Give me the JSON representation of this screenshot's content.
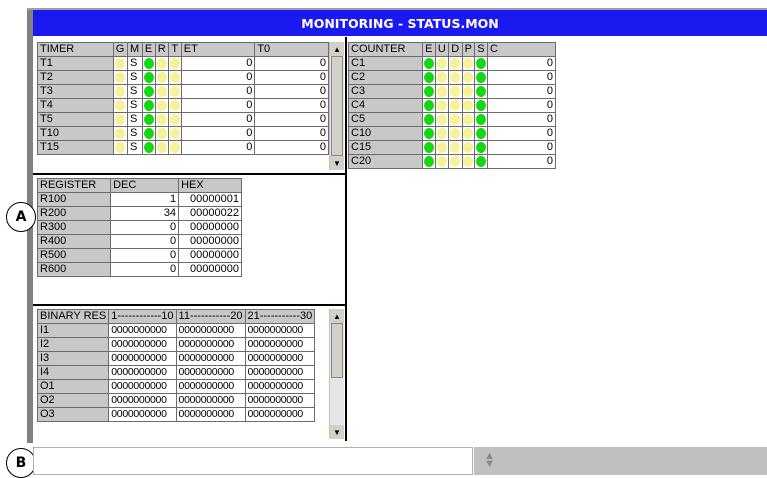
{
  "window": {
    "title": "MONITORING - STATUS.MON"
  },
  "timer": {
    "headers": [
      "TIMER",
      "G",
      "M",
      "E",
      "R",
      "T",
      "ET",
      "T0"
    ],
    "rows": [
      {
        "name": "T1",
        "m": "S",
        "et": "0",
        "t0": "0"
      },
      {
        "name": "T2",
        "m": "S",
        "et": "0",
        "t0": "0"
      },
      {
        "name": "T3",
        "m": "S",
        "et": "0",
        "t0": "0"
      },
      {
        "name": "T4",
        "m": "S",
        "et": "0",
        "t0": "0"
      },
      {
        "name": "T5",
        "m": "S",
        "et": "0",
        "t0": "0"
      },
      {
        "name": "T10",
        "m": "S",
        "et": "0",
        "t0": "0"
      },
      {
        "name": "T15",
        "m": "S",
        "et": "0",
        "t0": "0"
      }
    ]
  },
  "counter": {
    "headers": [
      "COUNTER",
      "E",
      "U",
      "D",
      "P",
      "S",
      "C"
    ],
    "rows": [
      {
        "name": "C1",
        "value": "0"
      },
      {
        "name": "C2",
        "value": "0"
      },
      {
        "name": "C3",
        "value": "0"
      },
      {
        "name": "C4",
        "value": "0"
      },
      {
        "name": "C5",
        "value": "0"
      },
      {
        "name": "C10",
        "value": "0"
      },
      {
        "name": "C15",
        "value": "0"
      },
      {
        "name": "C20",
        "value": "0"
      }
    ]
  },
  "register": {
    "headers": [
      "REGISTER",
      "DEC",
      "HEX"
    ],
    "rows": [
      {
        "name": "R100",
        "dec": "1",
        "hex": "00000001"
      },
      {
        "name": "R200",
        "dec": "34",
        "hex": "00000022"
      },
      {
        "name": "R300",
        "dec": "0",
        "hex": "00000000"
      },
      {
        "name": "R400",
        "dec": "0",
        "hex": "00000000"
      },
      {
        "name": "R500",
        "dec": "0",
        "hex": "00000000"
      },
      {
        "name": "R600",
        "dec": "0",
        "hex": "00000000"
      }
    ]
  },
  "binary": {
    "headers": [
      "BINARY RES",
      "1------------10",
      "11-----------20",
      "21-----------30"
    ],
    "rows": [
      {
        "name": "I1",
        "b1": "0000000000",
        "b2": "0000000000",
        "b3": "0000000000"
      },
      {
        "name": "I2",
        "b1": "0000000000",
        "b2": "0000000000",
        "b3": "0000000000"
      },
      {
        "name": "I3",
        "b1": "0000000000",
        "b2": "0000000000",
        "b3": "0000000000"
      },
      {
        "name": "I4",
        "b1": "0000000000",
        "b2": "0000000000",
        "b3": "0000000000"
      },
      {
        "name": "O1",
        "b1": "0000000000",
        "b2": "0000000000",
        "b3": "0000000000"
      },
      {
        "name": "O2",
        "b1": "0000000000",
        "b2": "0000000000",
        "b3": "0000000000"
      },
      {
        "name": "O3",
        "b1": "0000000000",
        "b2": "0000000000",
        "b3": "0000000000"
      }
    ]
  },
  "callouts": {
    "a": "A",
    "b": "B"
  },
  "status_input": {
    "value": ""
  },
  "colors": {
    "title_bar": "#1a1af0",
    "indicator_on": "#14d814",
    "indicator_off": "#f5f29a",
    "header_bg": "#c8c8c8"
  },
  "icons": {
    "scroll_up": "triangle-up-icon",
    "scroll_down": "triangle-down-icon",
    "spinner": "up-down-spinner-icon"
  }
}
